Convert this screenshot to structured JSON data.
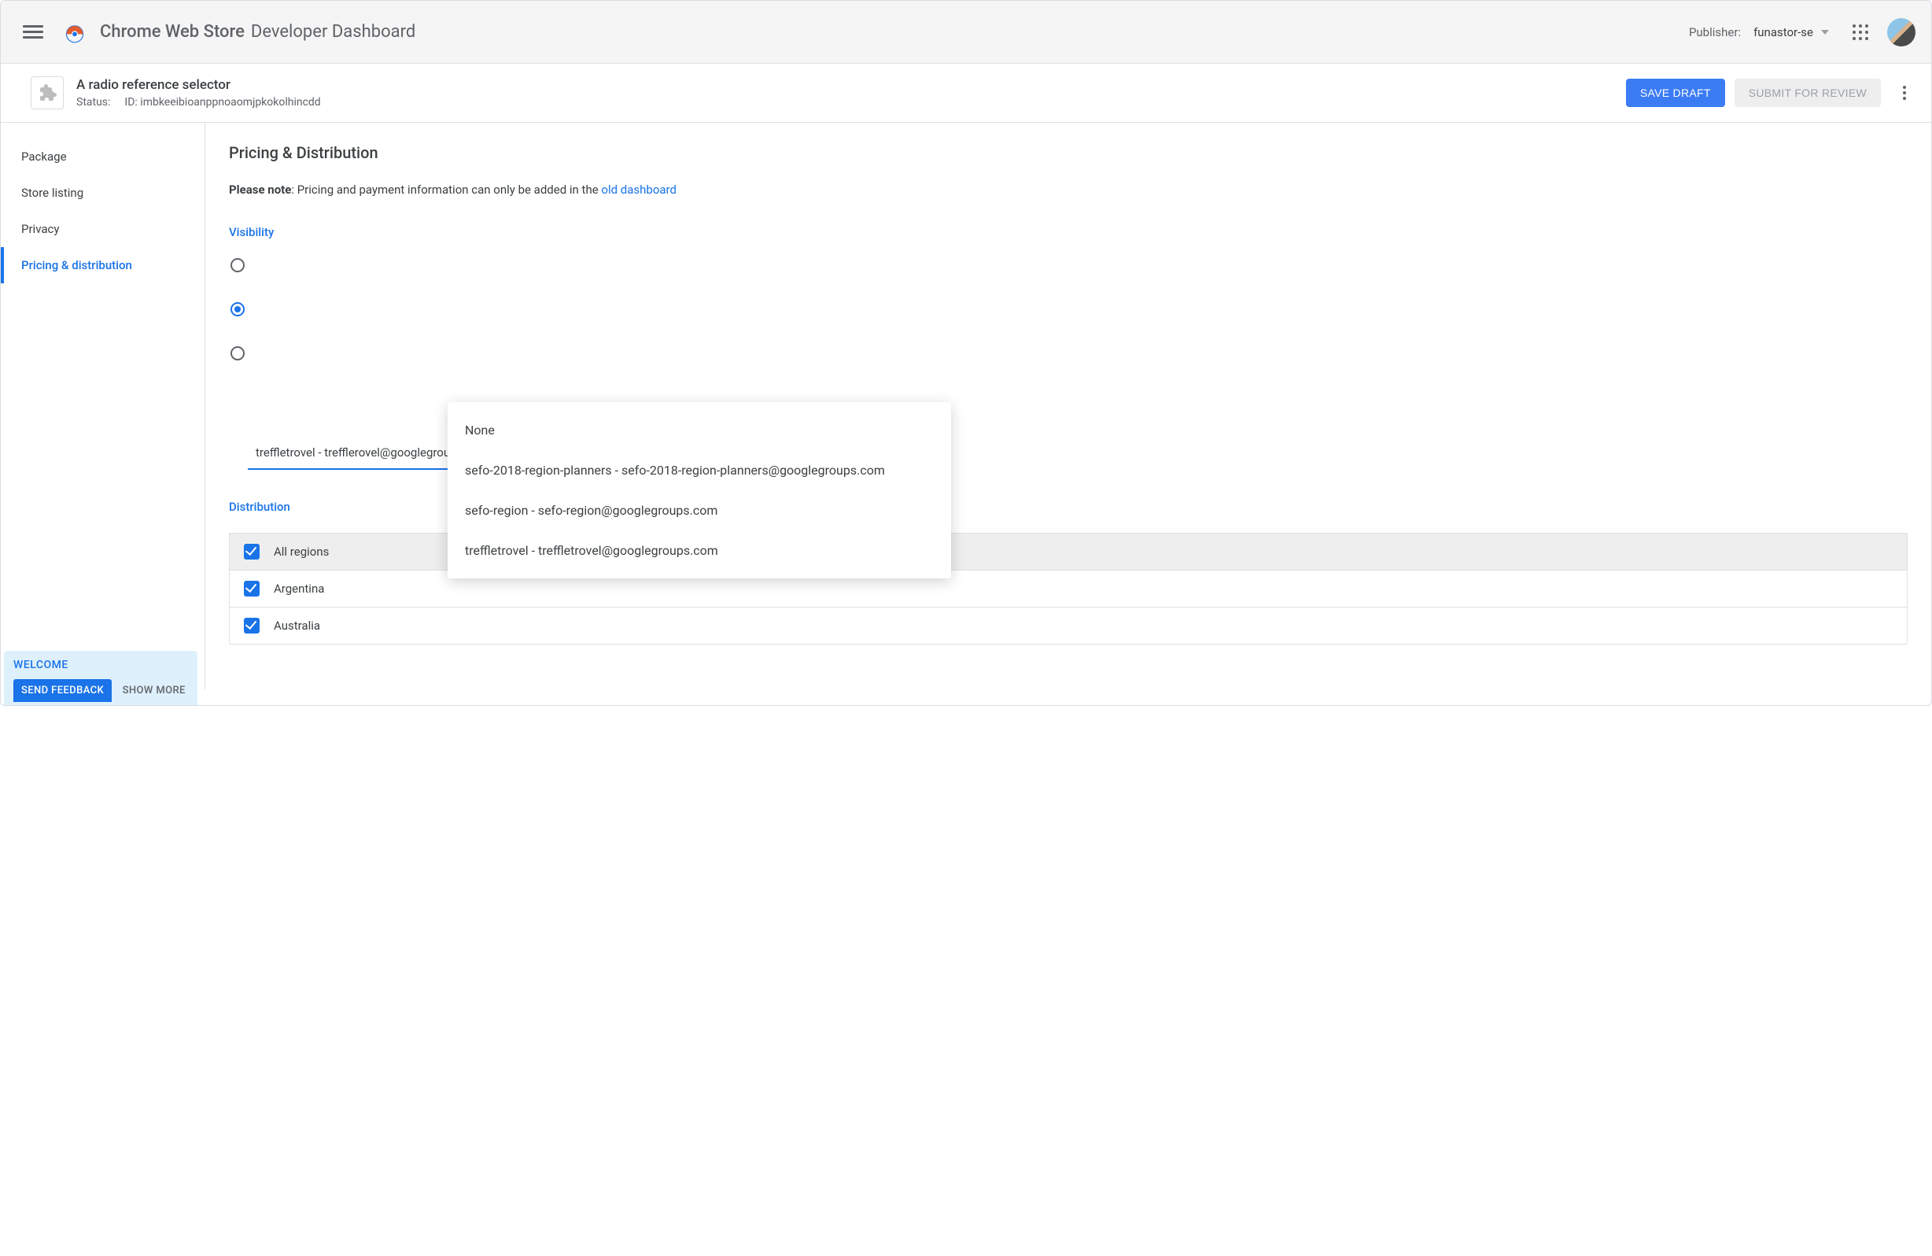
{
  "header": {
    "title_strong": "Chrome Web Store",
    "title_light": "Developer Dashboard",
    "publisher_label": "Publisher:",
    "publisher_value": "funastor-se"
  },
  "item": {
    "name": "A radio reference selector",
    "status_label": "Status:",
    "id_label": "ID:",
    "id_value": "imbkeeibioanppnoaomjpkokolhincdd",
    "save_draft": "Save Draft",
    "submit_review": "Submit for Review"
  },
  "sidebar": {
    "items": [
      {
        "label": "Package"
      },
      {
        "label": "Store listing"
      },
      {
        "label": "Privacy"
      },
      {
        "label": "Pricing & distribution",
        "active": true
      }
    ]
  },
  "main": {
    "heading": "Pricing & Distribution",
    "note_bold": "Please note",
    "note_rest": ": Pricing and payment information can only be added in the ",
    "note_link": "old dashboard",
    "visibility_label": "Visibility",
    "distribution_label": "Distribution",
    "select_value": "treffletrovel - trefflerovel@googlegroups.com",
    "menu_items": [
      "None",
      "sefo-2018-region-planners - sefo-2018-region-planners@googlegroups.com",
      "sefo-region - sefo-region@googlegroups.com",
      "treffletrovel - treffletrovel@googlegroups.com"
    ],
    "regions": [
      "All regions",
      "Argentina",
      "Australia"
    ]
  },
  "toast": {
    "title": "WELCOME",
    "btn": "SEND FEEDBACK",
    "more": "SHOW MORE"
  }
}
